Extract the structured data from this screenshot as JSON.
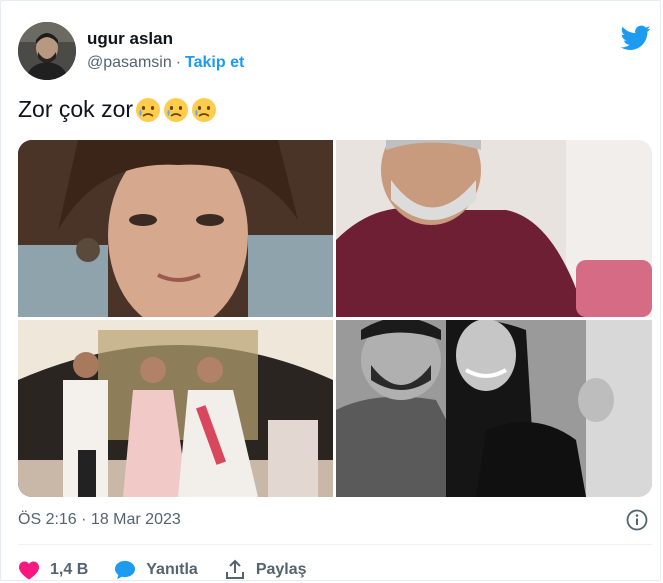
{
  "tweet": {
    "author_name": "ugur aslan",
    "handle": "@pasamsin",
    "separator": "·",
    "follow_label": "Takip et",
    "text": "Zor çok zor",
    "emoji_count_note": "",
    "timestamp": "ÖS 2:16 · 18 Mar 2023",
    "likes": "1,4 B",
    "reply_label": "Yanıtla",
    "share_label": "Paylaş"
  },
  "colors": {
    "accent": "#1d9bf0",
    "like": "#f91880",
    "text_secondary": "#536471"
  },
  "icons": {
    "brand": "twitter-bird-icon",
    "info": "info-icon",
    "like": "heart-icon",
    "reply": "speech-bubble-icon",
    "share": "share-upload-icon",
    "emoji": "crying-face-emoji"
  }
}
